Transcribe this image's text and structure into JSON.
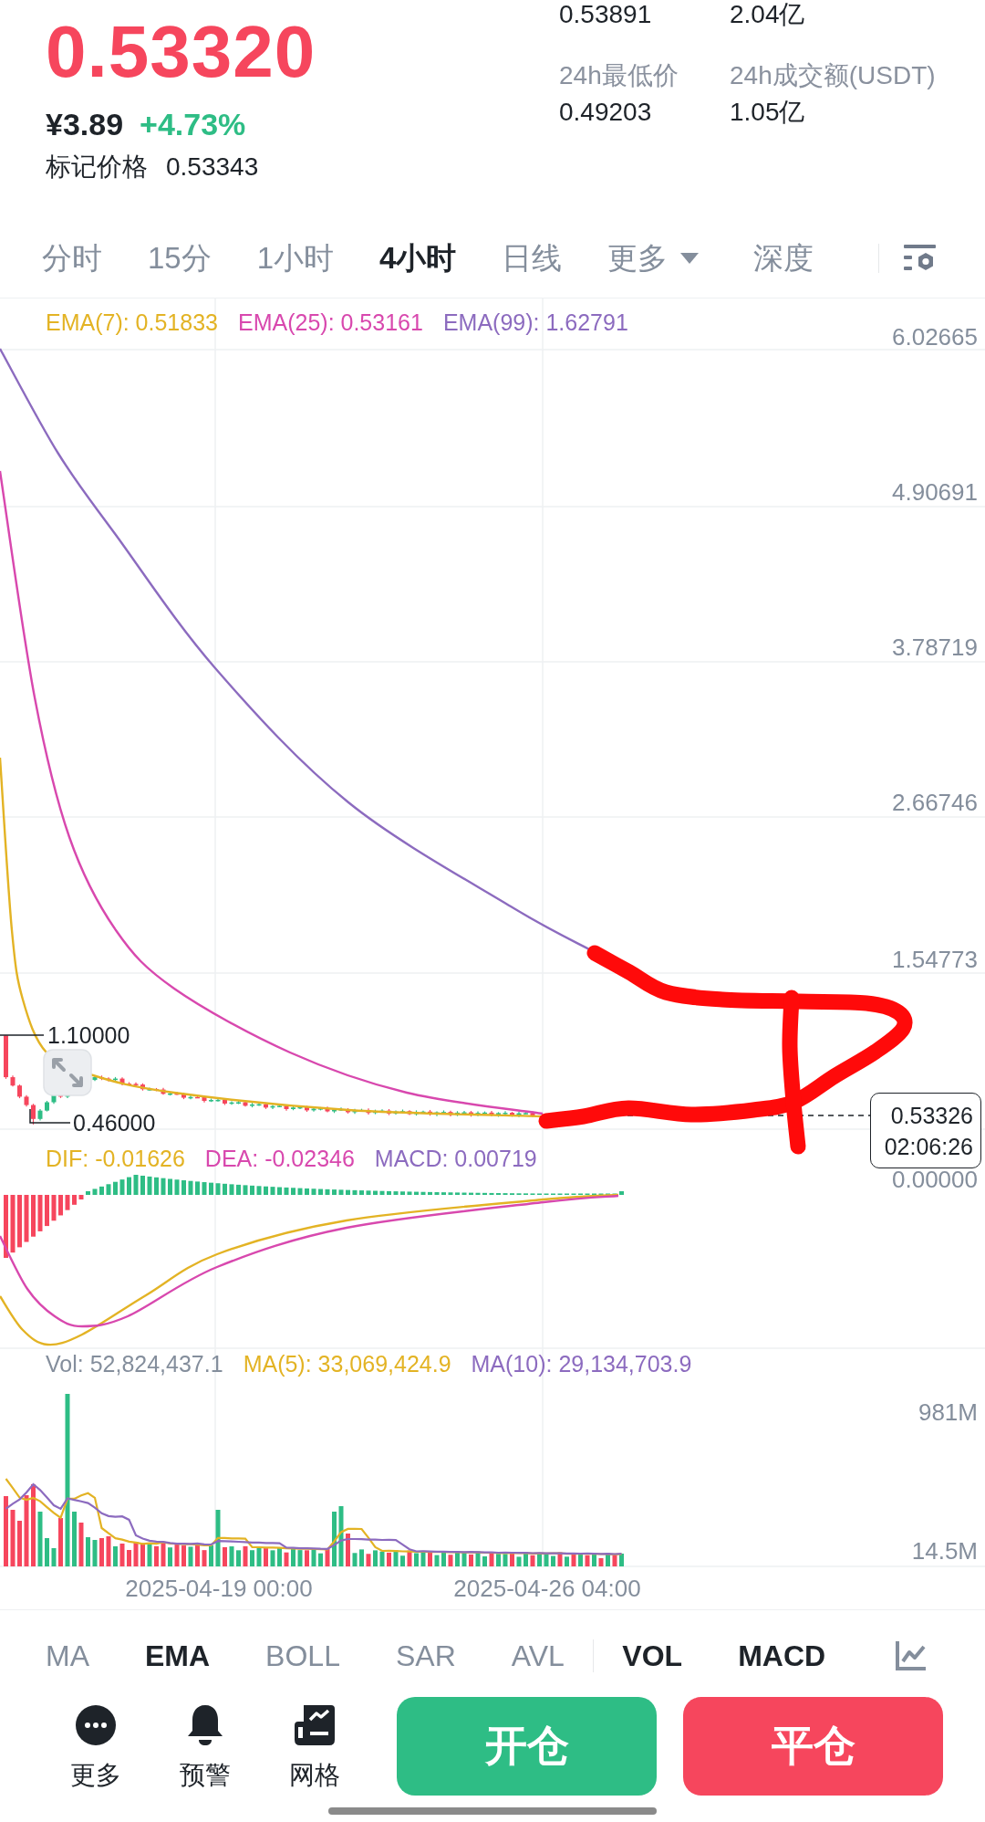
{
  "ticker": {
    "last_price": "0.53320",
    "cny_price": "¥3.89",
    "change": "+4.73%",
    "mark_price_label": "标记价格",
    "mark_price": "0.53343"
  },
  "stats": [
    {
      "value": "0.53891"
    },
    {
      "value": "2.04亿"
    },
    {
      "label": "24h最低价",
      "value": "0.49203"
    },
    {
      "label": "24h成交额(USDT)",
      "value": "1.05亿"
    }
  ],
  "timeframe_tabs": [
    {
      "label": "分时",
      "selected": false,
      "kind": "tab"
    },
    {
      "label": "15分",
      "selected": false,
      "kind": "tab"
    },
    {
      "label": "1小时",
      "selected": false,
      "kind": "tab"
    },
    {
      "label": "4小时",
      "selected": true,
      "kind": "tab"
    },
    {
      "label": "日线",
      "selected": false,
      "kind": "tab"
    },
    {
      "label": "更多",
      "selected": false,
      "kind": "dropdown"
    },
    {
      "label": "深度",
      "selected": false,
      "kind": "tab"
    }
  ],
  "main_chart": {
    "legend": [
      {
        "label": "EMA(7): 0.51833",
        "color": "#e3b324"
      },
      {
        "label": "EMA(25): 0.53161",
        "color": "#d848ae"
      },
      {
        "label": "EMA(99): 1.62791",
        "color": "#8c6bbf"
      }
    ],
    "y_axis_labels": [
      "6.02665",
      "4.90691",
      "3.78719",
      "2.66746",
      "1.54773"
    ],
    "high_marker": "1.10000",
    "low_marker": "0.46000",
    "price_tag": {
      "price": "0.53326",
      "countdown": "02:06:26"
    }
  },
  "macd_chart": {
    "legend": [
      {
        "label": "DIF: -0.01626",
        "color": "#e3b324"
      },
      {
        "label": "DEA: -0.02346",
        "color": "#d848ae"
      },
      {
        "label": "MACD: 0.00719",
        "color": "#8c6bbf"
      }
    ],
    "y_axis_labels": [
      "0.00000"
    ]
  },
  "volume_chart": {
    "legend": [
      {
        "label": "Vol: 52,824,437.1",
        "color": "#848e9c"
      },
      {
        "label": "MA(5): 33,069,424.9",
        "color": "#e3b324"
      },
      {
        "label": "MA(10): 29,134,703.9",
        "color": "#8c6bbf"
      }
    ],
    "y_axis_labels": [
      "981M",
      "14.5M"
    ],
    "x_axis_labels": [
      "2025-04-19 00:00",
      "2025-04-26 04:00"
    ]
  },
  "indicators": {
    "main": [
      {
        "label": "MA",
        "selected": false
      },
      {
        "label": "EMA",
        "selected": true
      },
      {
        "label": "BOLL",
        "selected": false
      },
      {
        "label": "SAR",
        "selected": false
      },
      {
        "label": "AVL",
        "selected": false
      }
    ],
    "sub": [
      {
        "label": "VOL",
        "selected": true
      },
      {
        "label": "MACD",
        "selected": true
      }
    ]
  },
  "actions": [
    {
      "label": "更多",
      "kind": "more"
    },
    {
      "label": "预警",
      "kind": "alert"
    },
    {
      "label": "网格",
      "kind": "grid"
    }
  ],
  "trade_buttons": [
    {
      "label": "开仓",
      "kind": "open"
    },
    {
      "label": "平仓",
      "kind": "close"
    }
  ]
}
